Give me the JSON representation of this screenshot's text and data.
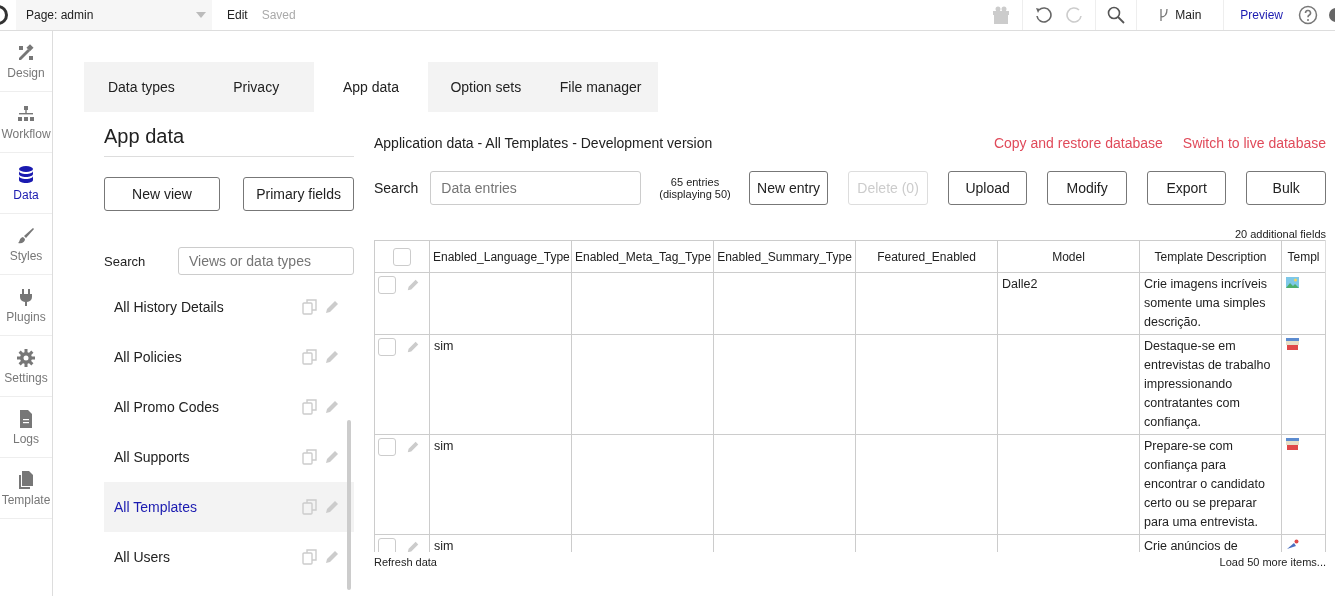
{
  "topbar": {
    "page": "Page: admin",
    "mode": "Edit",
    "status": "Saved",
    "branch": "Main",
    "preview": "Preview"
  },
  "nav": [
    {
      "label": "Design",
      "kind": "design",
      "selected": false
    },
    {
      "label": "Workflow",
      "kind": "workflow",
      "selected": false
    },
    {
      "label": "Data",
      "kind": "data",
      "selected": true
    },
    {
      "label": "Styles",
      "kind": "styles",
      "selected": false
    },
    {
      "label": "Plugins",
      "kind": "plugins",
      "selected": false
    },
    {
      "label": "Settings",
      "kind": "settings",
      "selected": false
    },
    {
      "label": "Logs",
      "kind": "logs",
      "selected": false
    },
    {
      "label": "Template",
      "kind": "template",
      "selected": false
    }
  ],
  "tabs": [
    {
      "label": "Data types",
      "selected": false
    },
    {
      "label": "Privacy",
      "selected": false
    },
    {
      "label": "App data",
      "selected": true
    },
    {
      "label": "Option sets",
      "selected": false
    },
    {
      "label": "File manager",
      "selected": false
    }
  ],
  "panel": {
    "title": "App data",
    "buttons": [
      "New view",
      "Primary fields"
    ],
    "search_label": "Search",
    "search_placeholder": "Views or data types",
    "views": [
      {
        "label": "All History Details",
        "selected": false
      },
      {
        "label": "All Policies",
        "selected": false
      },
      {
        "label": "All Promo Codes",
        "selected": false
      },
      {
        "label": "All Supports",
        "selected": false
      },
      {
        "label": "All Templates",
        "selected": true
      },
      {
        "label": "All Users",
        "selected": false
      }
    ]
  },
  "data": {
    "title": "Application data - All Templates - Development version",
    "links": [
      "Copy and restore database",
      "Switch to live database"
    ],
    "search_label": "Search",
    "search_placeholder": "Data entries",
    "count": "65 entries",
    "displaying": "(displaying 50)",
    "buttons": [
      {
        "label": "New entry",
        "disabled": false
      },
      {
        "label": "Delete (0)",
        "disabled": true
      },
      {
        "label": "Upload",
        "disabled": false
      },
      {
        "label": "Modify",
        "disabled": false
      },
      {
        "label": "Export",
        "disabled": false
      },
      {
        "label": "Bulk",
        "disabled": false
      }
    ],
    "additional": "20 additional fields",
    "all_checked": false,
    "columns": [
      "Enabled_Language_Type",
      "Enabled_Meta_Tag_Type",
      "Enabled_Summary_Type",
      "Featured_Enabled",
      "Model",
      "Template Description",
      "Templ"
    ],
    "rows": [
      {
        "checked": false,
        "kind": "image",
        "cells": [
          "",
          "",
          "",
          "",
          "Dalle2",
          "Crie imagens incríveis somente uma simples descrição."
        ]
      },
      {
        "checked": false,
        "kind": "form",
        "cells": [
          "sim",
          "",
          "",
          "",
          "",
          "Destaque-se em entrevistas de trabalho impressionando contratantes com confiança."
        ]
      },
      {
        "checked": false,
        "kind": "form",
        "cells": [
          "sim",
          "",
          "",
          "",
          "",
          "Prepare-se com confiança para encontrar o candidato certo ou se preparar para uma entrevista."
        ]
      },
      {
        "checked": false,
        "kind": "megaphone",
        "cells": [
          "sim",
          "",
          "",
          "",
          "",
          "Crie anúncios de"
        ]
      }
    ],
    "refresh": "Refresh data",
    "load_more": "Load 50 more items..."
  }
}
